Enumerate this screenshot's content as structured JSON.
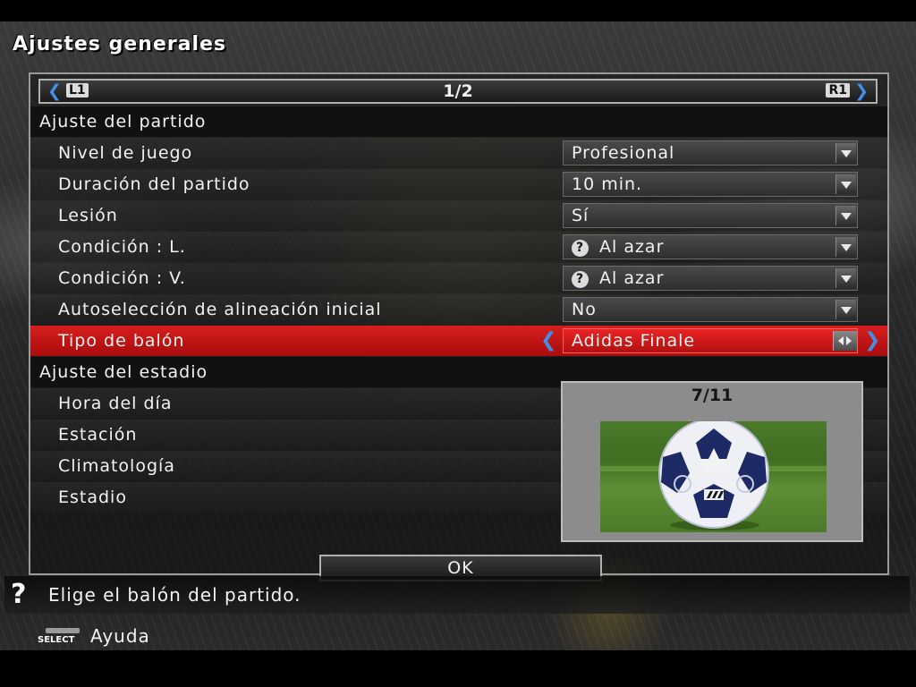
{
  "screen_title": "Ajustes generales",
  "pagination": {
    "left_key": "L1",
    "right_key": "R1",
    "page": "1/2"
  },
  "sections": {
    "match": "Ajuste del partido",
    "stadium": "Ajuste del estadio"
  },
  "match_settings": [
    {
      "label": "Nivel de juego",
      "value": "Profesional"
    },
    {
      "label": "Duración del partido",
      "value": "10 min."
    },
    {
      "label": "Lesión",
      "value": "Sí"
    },
    {
      "label": "Condición : L.",
      "value": "Al azar",
      "icon": "?"
    },
    {
      "label": "Condición : V.",
      "value": "Al azar",
      "icon": "?"
    },
    {
      "label": "Autoselección de alineación inicial",
      "value": "No"
    },
    {
      "label": "Tipo de balón",
      "value": "Adidas Finale",
      "selected": true
    }
  ],
  "stadium_settings": [
    {
      "label": "Hora del día"
    },
    {
      "label": "Estación"
    },
    {
      "label": "Climatología"
    },
    {
      "label": "Estadio"
    }
  ],
  "ball_preview": {
    "count": "7/11",
    "image": "soccer-ball-image"
  },
  "ok_label": "OK",
  "help": {
    "icon": "?",
    "text": "Elige el balón del partido."
  },
  "footer": {
    "button_key": "SELECT",
    "label": "Ayuda"
  },
  "colors": {
    "selected_row": "#d81e1e",
    "arrow_blue": "#3f8fe8"
  }
}
